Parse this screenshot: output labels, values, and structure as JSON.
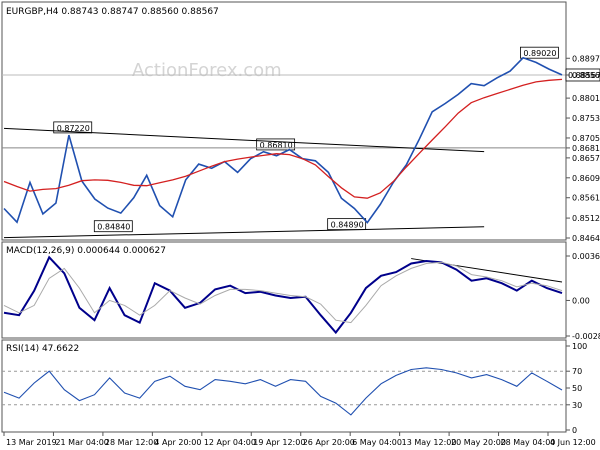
{
  "chart_data": [
    {
      "type": "line",
      "panel": "price",
      "title": "EURGBP,H4  0.88743 0.88747 0.88560 0.88567",
      "watermark": "ActionForex.com",
      "ylim": [
        0.8464,
        0.8994
      ],
      "y_ticks": [
        "0.88970",
        "0.88567",
        "0.88010",
        "0.87530",
        "0.87050",
        "0.86810",
        "0.86570",
        "0.86090",
        "0.85610",
        "0.85120",
        "0.84640"
      ],
      "last_price": 0.88567,
      "horizontal_line": 0.8681,
      "x": [
        "13 Mar 2019",
        "21 Mar 04:00",
        "28 Mar 12:00",
        "4 Apr 20:00",
        "12 Apr 04:00",
        "19 Apr 12:00",
        "26 Apr 20:00",
        "6 May 04:00",
        "13 May 12:00",
        "20 May 20:00",
        "28 May 04:00",
        "4 Jun 12:00"
      ],
      "series": [
        {
          "name": "",
          "color": "#2050b0",
          "values": [
            0.8535,
            0.8502,
            0.8598,
            0.8522,
            0.8548,
            0.8712,
            0.8601,
            0.8558,
            0.8536,
            0.8524,
            0.8561,
            0.8615,
            0.8542,
            0.8515,
            0.8604,
            0.8642,
            0.8632,
            0.8648,
            0.8622,
            0.8655,
            0.8672,
            0.8662,
            0.8677,
            0.8655,
            0.865,
            0.8622,
            0.856,
            0.8535,
            0.8501,
            0.8545,
            0.8598,
            0.864,
            0.8702,
            0.8768,
            0.8788,
            0.881,
            0.8836,
            0.8831,
            0.885,
            0.8866,
            0.8898,
            0.8887,
            0.8871,
            0.8857
          ]
        },
        {
          "name": "",
          "color": "#d42020",
          "values": [
            0.86,
            0.8588,
            0.8577,
            0.8581,
            0.8583,
            0.8591,
            0.8602,
            0.8604,
            0.8603,
            0.8598,
            0.8591,
            0.859,
            0.8597,
            0.8604,
            0.8613,
            0.8625,
            0.8637,
            0.8648,
            0.8654,
            0.8659,
            0.8663,
            0.8667,
            0.8665,
            0.8655,
            0.864,
            0.8612,
            0.8585,
            0.8563,
            0.856,
            0.8573,
            0.86,
            0.8635,
            0.8668,
            0.87,
            0.8732,
            0.8765,
            0.879,
            0.8802,
            0.8812,
            0.8822,
            0.8832,
            0.884,
            0.8844,
            0.8846
          ]
        }
      ],
      "annotations": [
        {
          "label": "0.87220",
          "x": 5,
          "y": 0.8722
        },
        {
          "label": "0.84840",
          "x": 9,
          "y": 0.8484
        },
        {
          "label": "0.86810",
          "x": 25,
          "y": 0.8681
        },
        {
          "label": "0.84890",
          "x": 32,
          "y": 0.8489
        },
        {
          "label": "0.89020",
          "x": 51,
          "y": 0.8902
        }
      ],
      "trendlines": [
        {
          "color": "#000000",
          "from": [
            0,
            0.8728
          ],
          "to": [
            37,
            0.8672
          ]
        },
        {
          "color": "#000000",
          "from": [
            0,
            0.8465
          ],
          "to": [
            37,
            0.8491
          ]
        }
      ]
    },
    {
      "type": "line",
      "panel": "macd",
      "title": "MACD(12,26,9) 0.000644 0.000627",
      "ylim": [
        -0.002886,
        0.003608
      ],
      "y_ticks": [
        "0.003608",
        "0.00",
        "-0.002886"
      ],
      "series": [
        {
          "name": "",
          "color": "#00008b",
          "values": [
            -0.001,
            -0.0012,
            0.0008,
            0.0035,
            0.0022,
            -0.0006,
            -0.0016,
            0.001,
            -0.0012,
            -0.0018,
            0.0014,
            0.0008,
            -0.0006,
            -0.0002,
            0.0009,
            0.0012,
            0.0006,
            0.0007,
            0.0004,
            0.0002,
            0.0003,
            -0.0012,
            -0.0026,
            -0.001,
            0.001,
            0.002,
            0.0023,
            0.003,
            0.0032,
            0.0031,
            0.0025,
            0.0016,
            0.0018,
            0.0014,
            0.0008,
            0.0016,
            0.001,
            0.0006
          ]
        },
        {
          "name": "",
          "color": "#aaaaaa",
          "values": [
            -0.0004,
            -0.001,
            -0.0004,
            0.0018,
            0.0026,
            0.001,
            -0.001,
            0.0,
            -0.0004,
            -0.0012,
            -0.0004,
            0.0008,
            0.0002,
            -0.0003,
            0.0004,
            0.0009,
            0.0009,
            0.0008,
            0.0006,
            0.0004,
            0.0003,
            -0.0003,
            -0.0016,
            -0.0018,
            -0.0004,
            0.0012,
            0.002,
            0.0026,
            0.003,
            0.0031,
            0.0028,
            0.0021,
            0.0019,
            0.0016,
            0.0011,
            0.0014,
            0.0012,
            0.0008
          ]
        }
      ],
      "trendlines": [
        {
          "color": "#000000",
          "from": [
            27,
            0.0034
          ],
          "to": [
            37,
            0.0015
          ]
        }
      ]
    },
    {
      "type": "line",
      "panel": "rsi",
      "title": "RSI(14) 47.6622",
      "ylim": [
        0,
        100
      ],
      "y_ticks": [
        "100",
        "70",
        "50",
        "30",
        "0"
      ],
      "levels": [
        70,
        30
      ],
      "series": [
        {
          "name": "",
          "color": "#2050b0",
          "values": [
            45,
            38,
            56,
            70,
            48,
            35,
            42,
            62,
            44,
            38,
            58,
            64,
            52,
            48,
            60,
            58,
            55,
            60,
            52,
            60,
            58,
            40,
            32,
            18,
            38,
            55,
            65,
            72,
            74,
            72,
            68,
            62,
            66,
            60,
            52,
            68,
            58,
            47.66
          ]
        }
      ]
    }
  ]
}
